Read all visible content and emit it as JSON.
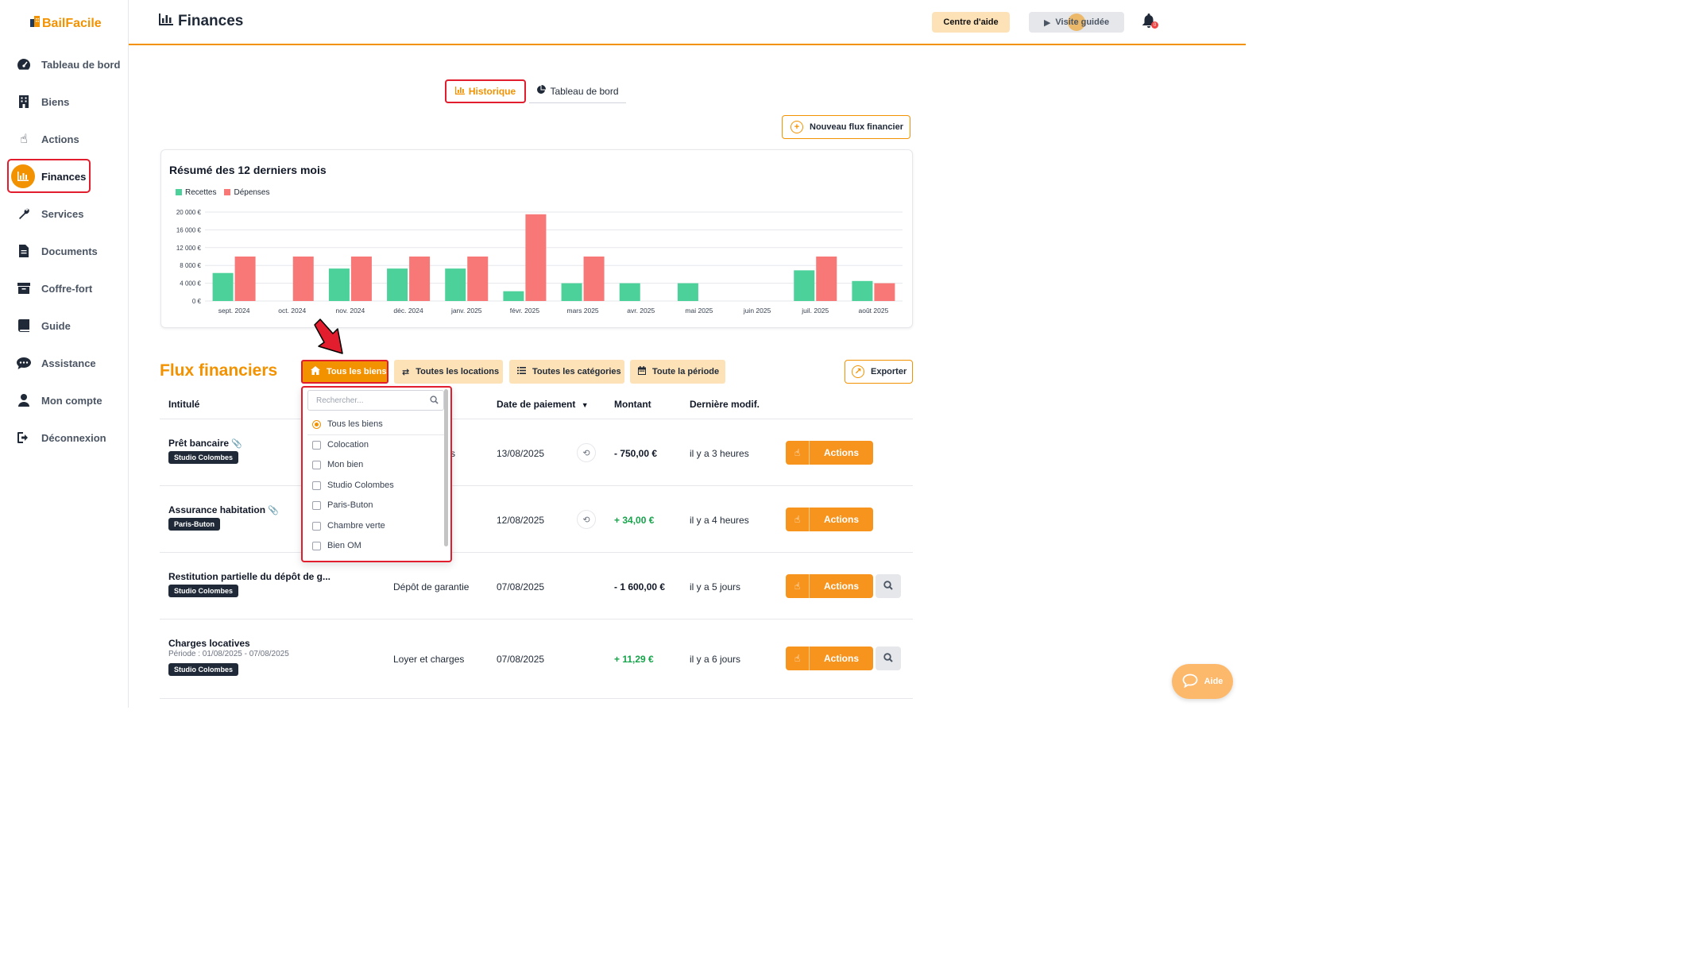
{
  "app": {
    "logo_text": "BailFacile"
  },
  "header": {
    "title": "Finances",
    "help_label": "Centre d'aide",
    "tour_label": "Visite guidée",
    "notification_count": "0"
  },
  "sidebar": {
    "items": [
      {
        "label": "Tableau de bord",
        "icon": "gauge-icon"
      },
      {
        "label": "Biens",
        "icon": "building-icon"
      },
      {
        "label": "Actions",
        "icon": "hand-pointer-icon"
      },
      {
        "label": "Finances",
        "icon": "chart-icon",
        "active": true
      },
      {
        "label": "Services",
        "icon": "wrench-icon"
      },
      {
        "label": "Documents",
        "icon": "document-icon"
      },
      {
        "label": "Coffre-fort",
        "icon": "archive-box-icon"
      },
      {
        "label": "Guide",
        "icon": "book-icon"
      },
      {
        "label": "Assistance",
        "icon": "chat-icon"
      },
      {
        "label": "Mon compte",
        "icon": "user-icon"
      },
      {
        "label": "Déconnexion",
        "icon": "logout-icon"
      }
    ]
  },
  "tabs": {
    "historique": "Historique",
    "tableau_de_bord": "Tableau de bord"
  },
  "new_flux_label": "Nouveau flux financier",
  "chart_data": {
    "type": "bar",
    "title": "Résumé des 12 derniers mois",
    "categories": [
      "sept. 2024",
      "oct. 2024",
      "nov. 2024",
      "déc. 2024",
      "janv. 2025",
      "févr. 2025",
      "mars 2025",
      "avr. 2025",
      "mai 2025",
      "juin 2025",
      "juil. 2025",
      "août 2025"
    ],
    "series": [
      {
        "name": "Recettes",
        "color": "#4cd19a",
        "values": [
          6300,
          0,
          7300,
          7300,
          7300,
          2200,
          4000,
          4000,
          4000,
          0,
          6900,
          4500
        ]
      },
      {
        "name": "Dépenses",
        "color": "#f87777",
        "values": [
          10000,
          10000,
          10000,
          10000,
          10000,
          19500,
          10000,
          0,
          0,
          0,
          10000,
          4000
        ]
      }
    ],
    "yticks": [
      "0 €",
      "4 000 €",
      "8 000 €",
      "12 000 €",
      "16 000 €",
      "20 000 €"
    ],
    "ylim": [
      0,
      20000
    ],
    "legend_placement": "top-left",
    "grid": true
  },
  "flux": {
    "title": "Flux financiers",
    "filters": {
      "biens": "Tous les biens",
      "locations": "Toutes les locations",
      "categories": "Toutes les catégories",
      "periode": "Toute la période"
    },
    "export_label": "Exporter",
    "columns": {
      "intitule": "Intitulé",
      "date": "Date de paiement",
      "montant": "Montant",
      "modif": "Dernière modif."
    },
    "rows": [
      {
        "title": "Prêt bancaire",
        "tag": "Studio Colombes",
        "category": "s",
        "date": "13/08/2025",
        "amount": "- 750,00 €",
        "modified": "il y a 3 heures",
        "actions": "Actions"
      },
      {
        "title": "Assurance habitation",
        "tag": "Paris-Buton",
        "category": "",
        "date": "12/08/2025",
        "amount": "+ 34,00 €",
        "modified": "il y a 4 heures",
        "actions": "Actions"
      },
      {
        "title": "Restitution partielle du dépôt de g...",
        "tag": "Studio Colombes",
        "category": "Dépôt de garantie",
        "date": "07/08/2025",
        "amount": "- 1 600,00 €",
        "modified": "il y a 5 jours",
        "actions": "Actions"
      },
      {
        "title": "Charges locatives",
        "subtitle": "Période : 01/08/2025 - 07/08/2025",
        "tag": "Studio Colombes",
        "category": "Loyer et charges",
        "date": "07/08/2025",
        "amount": "+ 11,29 €",
        "modified": "il y a 6 jours",
        "actions": "Actions"
      }
    ]
  },
  "dropdown": {
    "search_placeholder": "Rechercher...",
    "options": [
      "Tous les biens",
      "Colocation",
      "Mon bien",
      "Studio Colombes",
      "Paris-Buton",
      "Chambre verte",
      "Bien OM"
    ]
  },
  "aide_label": "Aide"
}
